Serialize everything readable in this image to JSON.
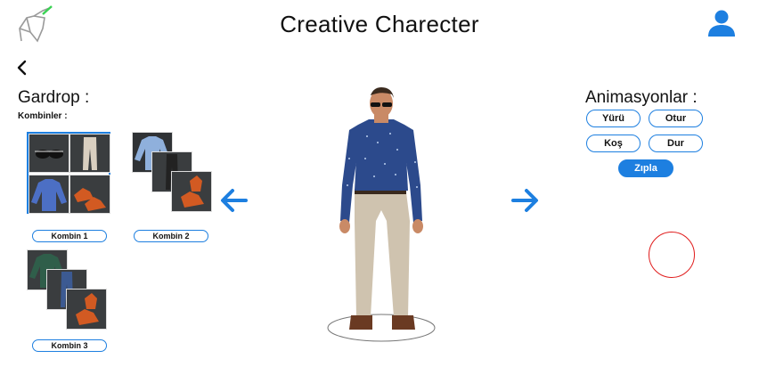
{
  "header": {
    "title": "Creative Charecter",
    "brand_accent": "#39d353"
  },
  "wardrobe": {
    "title": "Gardrop :",
    "subtitle": "Kombinler :",
    "combos": [
      {
        "label": "Kombin 1",
        "selected": true
      },
      {
        "label": "Kombin 2",
        "selected": false
      },
      {
        "label": "Kombin 3",
        "selected": false
      }
    ]
  },
  "animations": {
    "title": "Animasyonlar :",
    "buttons": [
      {
        "label": "Yürü",
        "active": false
      },
      {
        "label": "Otur",
        "active": false
      },
      {
        "label": "Koş",
        "active": false
      },
      {
        "label": "Dur",
        "active": false
      },
      {
        "label": "Zıpla",
        "active": true
      }
    ]
  },
  "icons": {
    "logo": "unicorn-logo",
    "user": "user-icon",
    "back": "chevron-left-icon",
    "prev": "arrow-left-icon",
    "next": "arrow-right-icon",
    "record": "record-circle-icon"
  },
  "colors": {
    "accent": "#1d7fe0",
    "record": "#e01b1b"
  }
}
